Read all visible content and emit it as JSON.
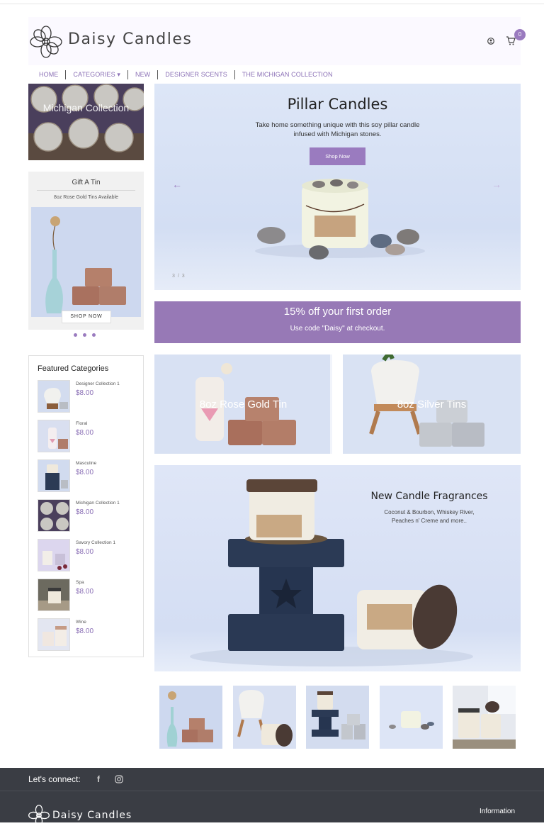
{
  "brand": {
    "name": "Daisy Candles"
  },
  "header": {
    "cart_count": "0"
  },
  "nav": {
    "items": [
      "HOME",
      "CATEGORIES ▾",
      "NEW",
      "DESIGNER SCENTS",
      "THE MICHIGAN COLLECTION"
    ]
  },
  "sidebar": {
    "michigan_card": {
      "title": "Michigan Collection"
    },
    "tin_card": {
      "title": "Gift A Tin",
      "subtitle": "8oz Rose Gold Tins Available",
      "button": "SHOP NOW"
    },
    "featured": {
      "title": "Featured Categories",
      "items": [
        {
          "name": "Designer Collection 1",
          "price": "$8.00"
        },
        {
          "name": "Floral",
          "price": "$8.00"
        },
        {
          "name": "Masculine",
          "price": "$8.00"
        },
        {
          "name": "Michigan Collection 1",
          "price": "$8.00"
        },
        {
          "name": "Savory Collection 1",
          "price": "$8.00"
        },
        {
          "name": "Spa",
          "price": "$8.00"
        },
        {
          "name": "Wine",
          "price": "$8.00"
        }
      ]
    }
  },
  "hero": {
    "title": "Pillar Candles",
    "text": "Take home something unique with this soy pillar candle infused with Michigan stones.",
    "button": "Shop Now",
    "counter": "3 / 3",
    "prev": "←",
    "next": "→"
  },
  "promo": {
    "title": "15% off your first order",
    "subtitle": "Use code \"Daisy\" at checkout."
  },
  "tiles": [
    {
      "label": "8oz Rose Gold Tin"
    },
    {
      "label": "8oz Silver Tins"
    }
  ],
  "feature_banner": {
    "title": "New Candle Fragrances",
    "subtitle": "Coconut & Bourbon, Whiskey River, Peaches n' Creme and more.."
  },
  "footer": {
    "connect": "Let's connect:",
    "facebook": "f",
    "info_heading": "Information"
  },
  "colors": {
    "accent": "#9a7bbf",
    "promo": "#9779b6",
    "footer": "#3a3d44"
  }
}
